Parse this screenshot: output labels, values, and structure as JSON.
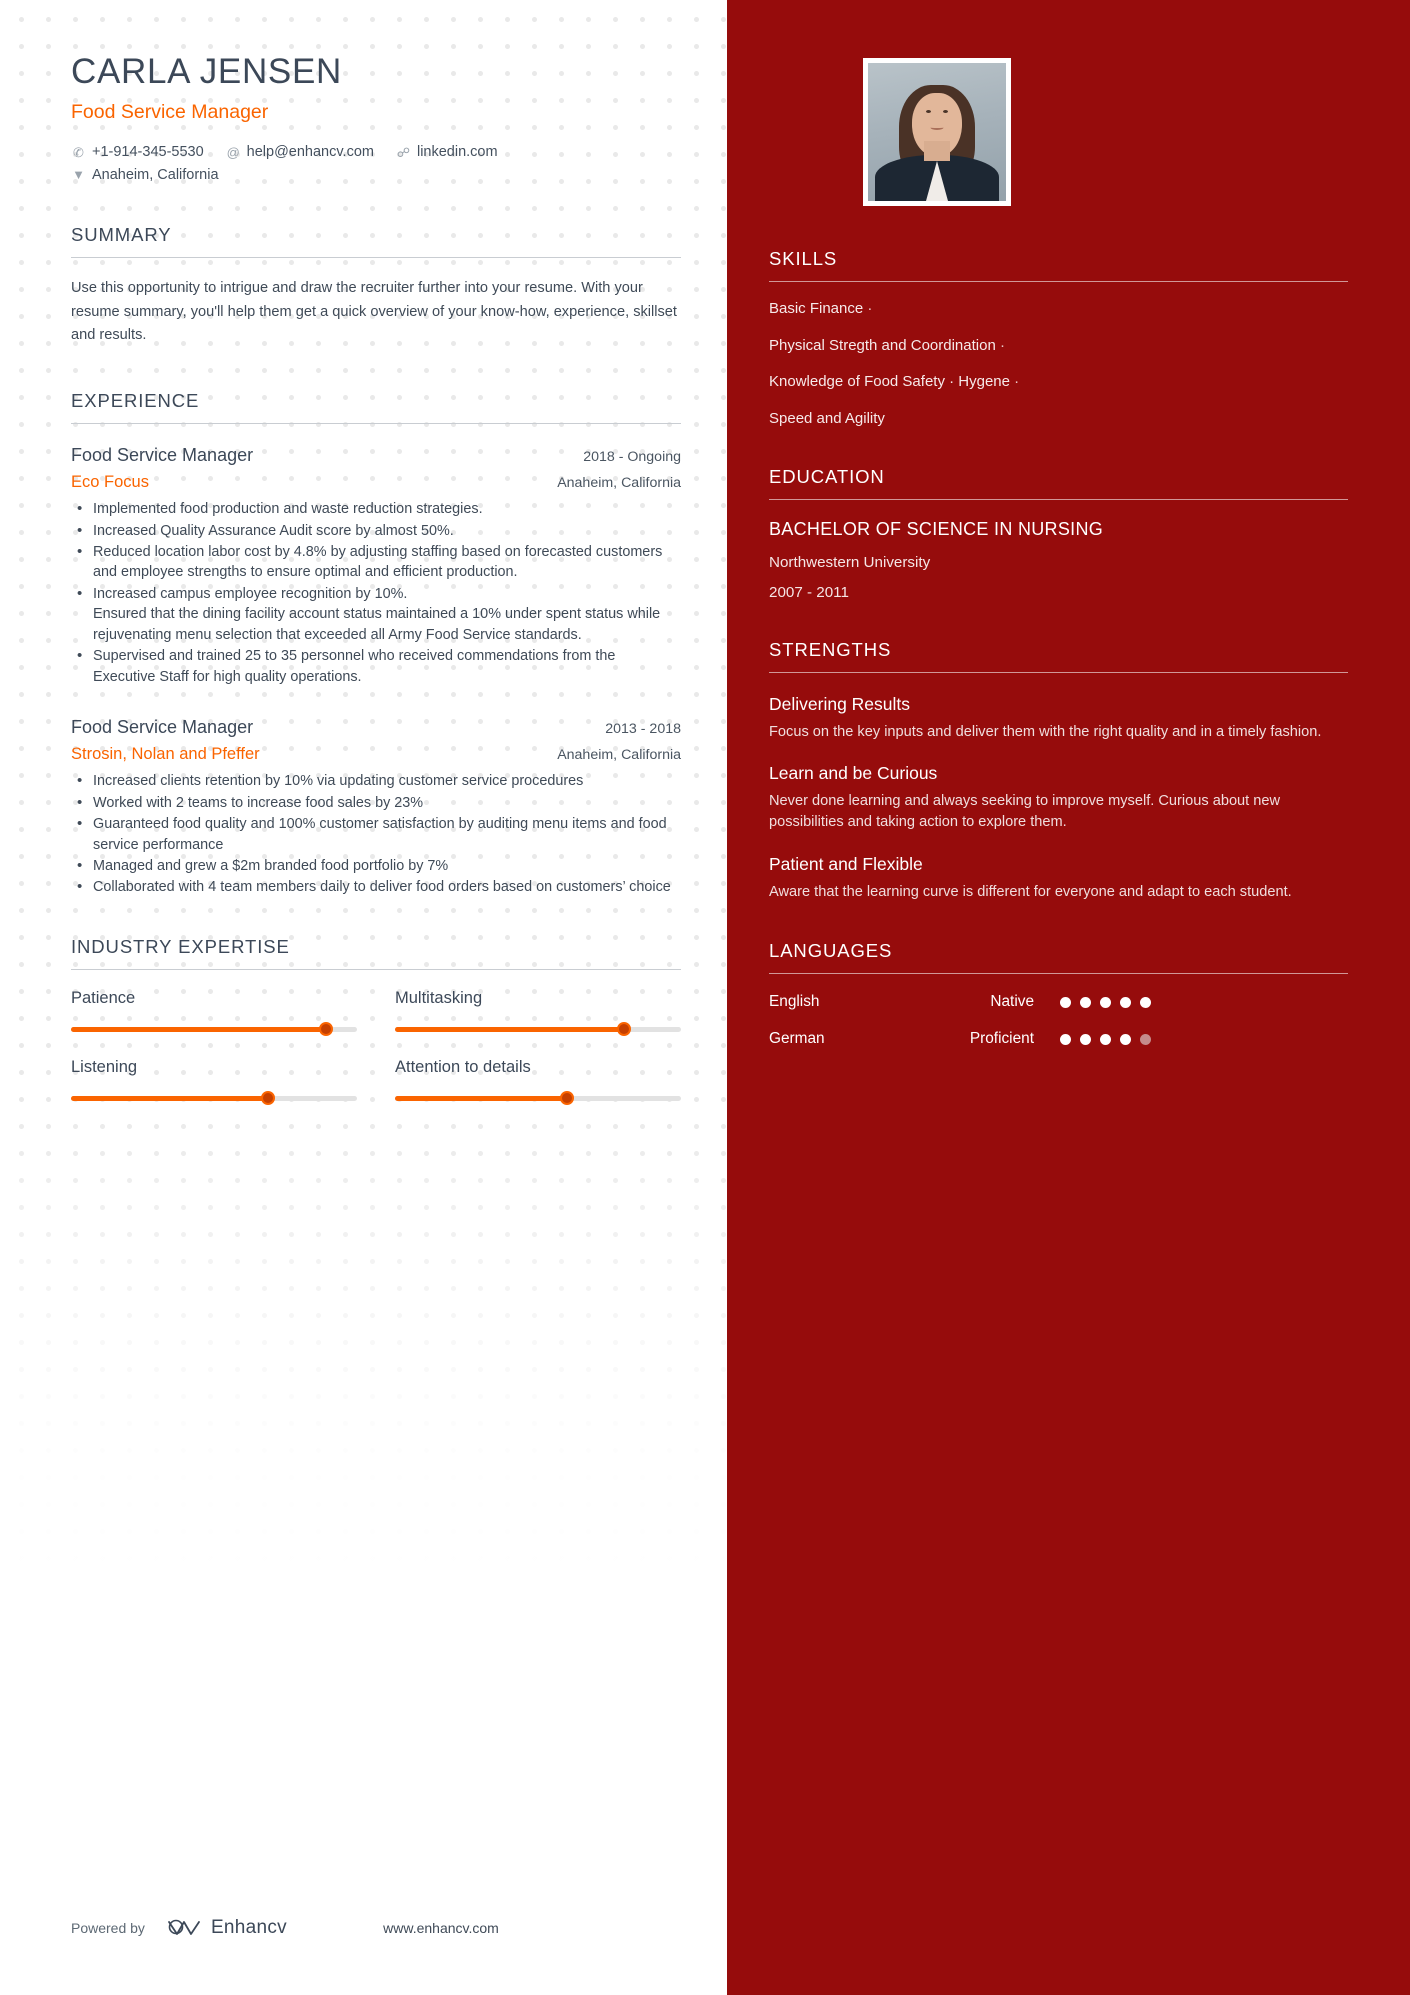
{
  "person": {
    "name": "CARLA JENSEN",
    "job_title": "Food Service Manager",
    "contacts": [
      {
        "icon": "phone-icon",
        "glyph": "✆",
        "text": "+1-914-345-5530"
      },
      {
        "icon": "email-icon",
        "glyph": "@",
        "text": "help@enhancv.com"
      },
      {
        "icon": "link-icon",
        "glyph": "☍",
        "text": "linkedin.com"
      }
    ],
    "location": {
      "icon": "location-pin-icon",
      "glyph": "▼",
      "text": "Anaheim, California"
    }
  },
  "summary": {
    "heading": "SUMMARY",
    "text": "Use this opportunity to intrigue and draw the recruiter further into your resume. With your resume summary, you'll help them get a quick overview of your know-how, experience, skillset and results."
  },
  "experience": {
    "heading": "EXPERIENCE",
    "entries": [
      {
        "role": "Food Service Manager",
        "dates": "2018 - Ongoing",
        "company": "Eco Focus",
        "location": "Anaheim, California",
        "bullets": [
          {
            "text": "Implemented food production and waste reduction strategies."
          },
          {
            "text": "Increased Quality Assurance Audit score by almost 50%."
          },
          {
            "text": "Reduced location labor cost by 4.8% by adjusting staffing based on forecasted customers and employee strengths to ensure optimal and efficient production."
          },
          {
            "text": "Increased campus employee recognition by 10%.",
            "sub": "Ensured that the dining facility account status maintained a 10% under spent status while rejuvenating menu selection that exceeded all Army Food Service standards."
          },
          {
            "text": "Supervised and trained 25 to 35 personnel who received commendations from the Executive Staff for high quality operations."
          }
        ]
      },
      {
        "role": "Food Service Manager",
        "dates": "2013 - 2018",
        "company": "Strosin, Nolan and Pfeffer",
        "location": "Anaheim, California",
        "bullets": [
          {
            "text": "Increased clients retention by 10% via updating customer service procedures"
          },
          {
            "text": "Worked with 2 teams to increase food sales by 23%"
          },
          {
            "text": "Guaranteed food quality and 100% customer satisfaction by auditing menu items and food service performance"
          },
          {
            "text": "Managed and grew a $2m branded food portfolio by 7%"
          },
          {
            "text": "Collaborated with 4 team members daily to deliver food orders based on customers’ choice"
          }
        ]
      }
    ]
  },
  "industry_expertise": {
    "heading": "INDUSTRY EXPERTISE",
    "items": [
      {
        "label": "Patience",
        "value": 89
      },
      {
        "label": "Multitasking",
        "value": 80
      },
      {
        "label": "Listening",
        "value": 69
      },
      {
        "label": "Attention to details",
        "value": 60
      }
    ]
  },
  "footer": {
    "powered_by": "Powered by",
    "brand": "Enhancv",
    "url": "www.enhancv.com"
  },
  "sidebar": {
    "skills": {
      "heading": "SKILLS",
      "items": [
        {
          "name": "Basic Finance",
          "sep": "·"
        },
        {
          "name": "Physical Stregth and Coordination",
          "sep": "·"
        },
        {
          "name": "Knowledge of Food Safety · Hygene",
          "sep": "·"
        },
        {
          "name": "Speed and Agility",
          "sep": ""
        }
      ]
    },
    "education": {
      "heading": "EDUCATION",
      "degree": "BACHELOR OF SCIENCE IN NURSING",
      "school": "Northwestern University",
      "dates": "2007 - 2011"
    },
    "strengths": {
      "heading": "STRENGTHS",
      "items": [
        {
          "title": "Delivering Results",
          "desc": "Focus on the key inputs and deliver them with the right quality and in a timely fashion."
        },
        {
          "title": "Learn and be Curious",
          "desc": "Never done learning and always seeking to improve myself. Curious about new possibilities and taking action to explore them."
        },
        {
          "title": "Patient and Flexible",
          "desc": "Aware that the learning curve is different for everyone and adapt to each student."
        }
      ]
    },
    "languages": {
      "heading": "LANGUAGES",
      "items": [
        {
          "name": "English",
          "level": "Native",
          "filled": 5,
          "total": 5
        },
        {
          "name": "German",
          "level": "Proficient",
          "filled": 4,
          "total": 5
        }
      ]
    }
  },
  "colors": {
    "accent_orange": "#fa6400",
    "sidebar_red": "#960c0c",
    "heading_dark": "#3c4858"
  }
}
